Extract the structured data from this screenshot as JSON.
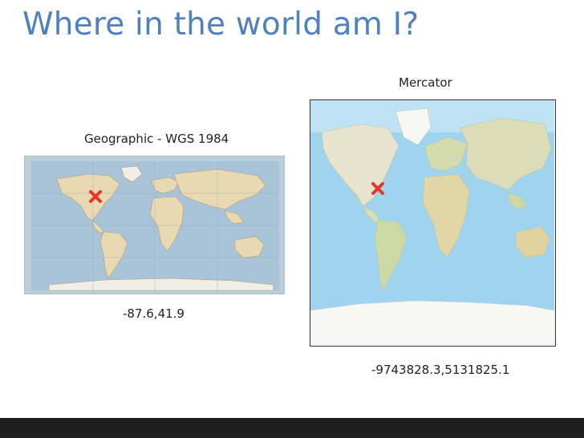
{
  "slide": {
    "title": "Where in the world am I?",
    "left_map": {
      "caption": "Geographic - WGS 1984",
      "coordinates": "-87.6,41.9",
      "marker_icon": "red-x-icon"
    },
    "right_map": {
      "caption": "Mercator",
      "coordinates": "-9743828.3,5131825.1",
      "marker_icon": "red-x-icon"
    }
  },
  "colors": {
    "title": "#4f81bd",
    "marker": "#e8342a",
    "ocean_geo": "#a9c4d8",
    "ocean_merc": "#9fd3ee",
    "land": "#e9d9b2",
    "footer": "#1e1e1e"
  }
}
